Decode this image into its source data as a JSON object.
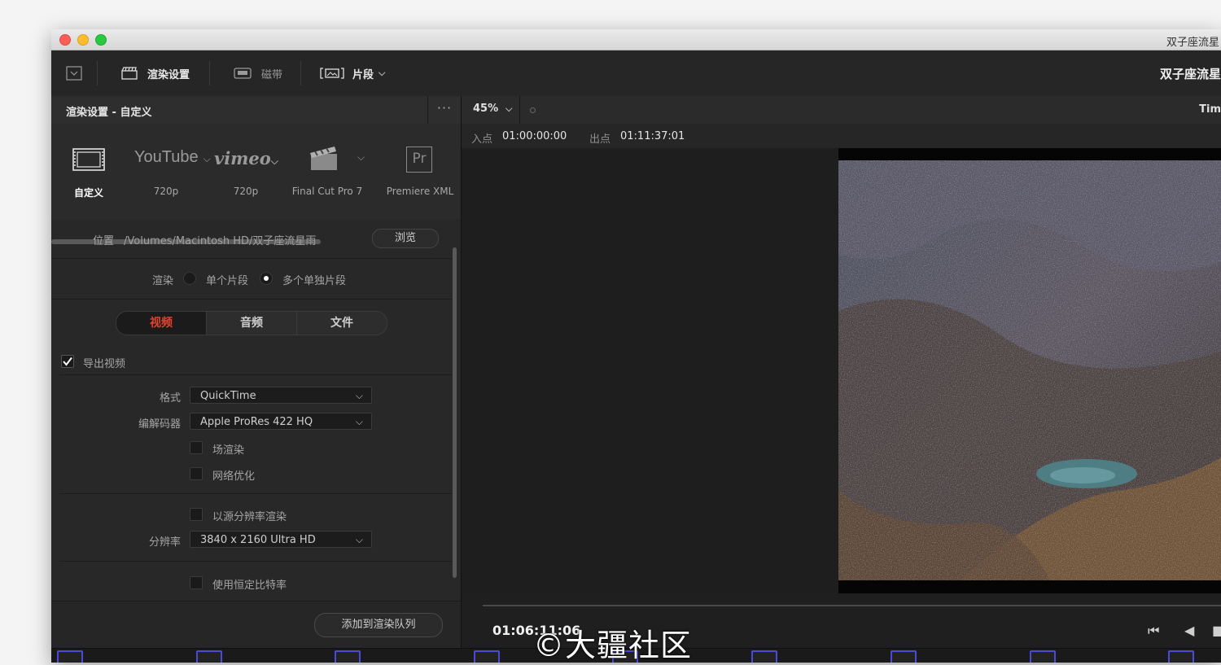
{
  "window": {
    "title": "双子座流星"
  },
  "toolbar": {
    "render_settings_label": "渲染设置",
    "tape_label": "磁带",
    "clip_label": "片段",
    "project_title": "双子座流星"
  },
  "left_panel": {
    "title": "渲染设置 - 自定义",
    "more_label": "···",
    "presets": [
      {
        "label": "自定义"
      },
      {
        "label": "720p",
        "brand": "YouTube"
      },
      {
        "label": "720p",
        "brand": "vimeo"
      },
      {
        "label": "Final Cut Pro 7"
      },
      {
        "label": "Premiere XML",
        "brand": "Pr"
      }
    ],
    "location_label": "位置",
    "location_value": "/Volumes/Macintosh HD/双子座流星雨",
    "browse_label": "浏览",
    "render_label": "渲染",
    "render_options": [
      "单个片段",
      "多个单独片段"
    ],
    "render_selected": "多个单独片段",
    "tabs": [
      "视频",
      "音频",
      "文件"
    ],
    "active_tab": "视频",
    "export_video_label": "导出视频",
    "export_video_checked": true,
    "format_label": "格式",
    "format_value": "QuickTime",
    "codec_label": "编解码器",
    "codec_value": "Apple ProRes 422 HQ",
    "field_render_label": "场渲染",
    "network_opt_label": "网络优化",
    "source_res_label": "以源分辨率渲染",
    "resolution_label": "分辨率",
    "resolution_value": "3840 x 2160 Ultra HD",
    "constant_bitrate_label": "使用恒定比特率",
    "add_to_queue_label": "添加到渲染队列"
  },
  "viewer": {
    "zoom": "45%",
    "right_label": "Tim",
    "in_label": "入点",
    "in_value": "01:00:00:00",
    "out_label": "出点",
    "out_value": "01:11:37:01",
    "timecode": "01:06:11:06"
  },
  "watermark": "©大疆社区",
  "colors": {
    "accent_tab": "#e0442e",
    "thumb_border": "#4b4bd8"
  }
}
